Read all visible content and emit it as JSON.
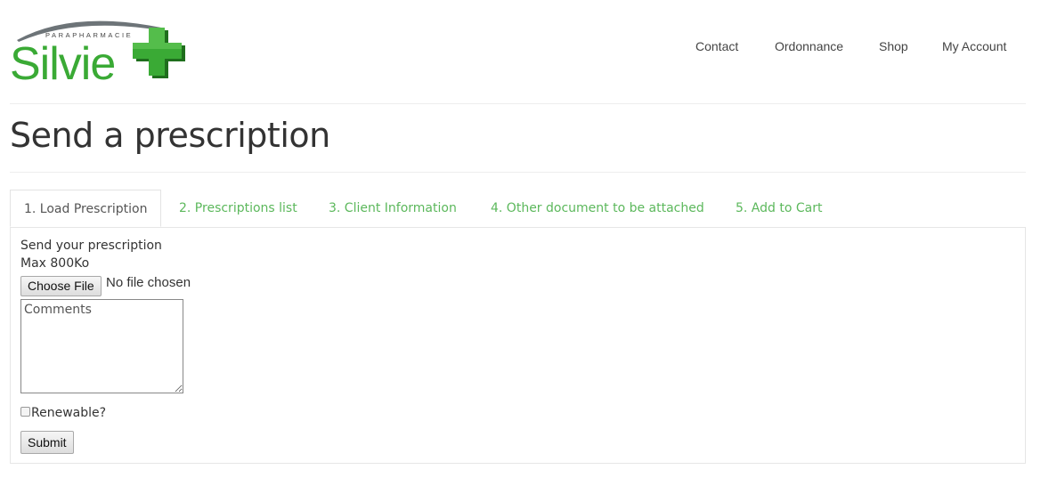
{
  "brand": {
    "small_text": "PARAPHARMACIE",
    "name": "Silvie",
    "colors": {
      "green": "#3aaa35",
      "dark_green": "#1f6e1d",
      "gray_arc": "#6d7478"
    }
  },
  "nav": {
    "contact": "Contact",
    "ordonnance": "Ordonnance",
    "shop": "Shop",
    "account": "My Account"
  },
  "page": {
    "title": "Send a prescription"
  },
  "tabs": [
    {
      "label": "1. Load Prescription",
      "active": true
    },
    {
      "label": "2. Prescriptions list",
      "active": false
    },
    {
      "label": "3. Client Information",
      "active": false
    },
    {
      "label": "4. Other document to be attached",
      "active": false
    },
    {
      "label": "5. Add to Cart",
      "active": false
    }
  ],
  "form": {
    "heading": "Send your prescription",
    "max_size": "Max 800Ko",
    "choose_file_label": "Choose File",
    "no_file_text": "No file chosen",
    "comments_placeholder": "Comments",
    "renewable_label": "Renewable?",
    "submit_label": "Submit"
  },
  "colors": {
    "tab_link": "#5cb85c",
    "text": "#333333"
  }
}
